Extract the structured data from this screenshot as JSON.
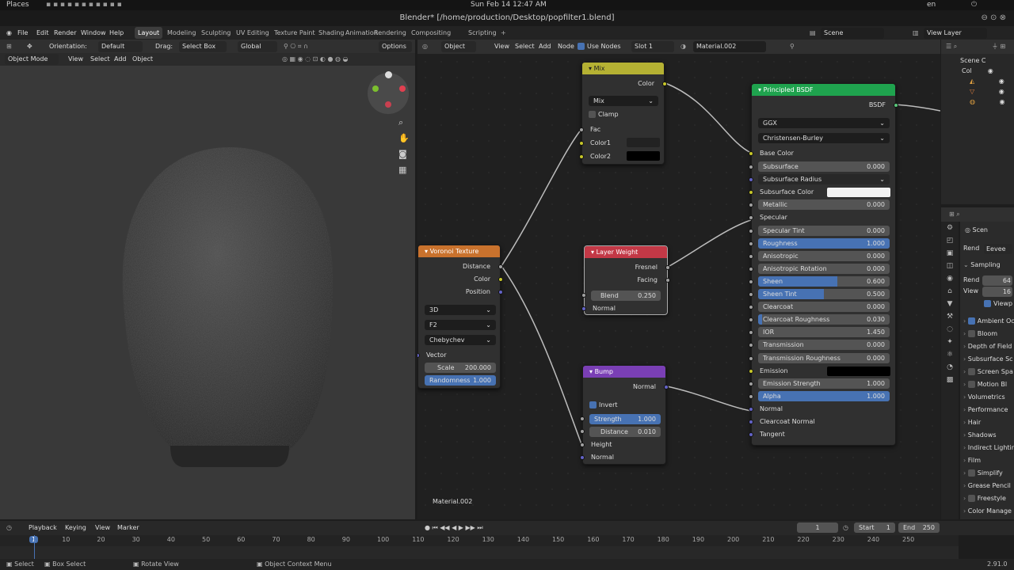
{
  "system": {
    "places": "Places",
    "datetime": "Sun Feb 14  12:47 AM",
    "lang": "en"
  },
  "window": {
    "title": "Blender* [/home/production/Desktop/popfilter1.blend]"
  },
  "menu": {
    "items": [
      "File",
      "Edit",
      "Render",
      "Window",
      "Help"
    ]
  },
  "workspaces": [
    "Layout",
    "Modeling",
    "Sculpting",
    "UV Editing",
    "Texture Paint",
    "Shading",
    "Animation",
    "Rendering",
    "Compositing",
    "Scripting"
  ],
  "active_workspace": "Layout",
  "scene": {
    "label": "Scene",
    "view_layer": "View Layer"
  },
  "viewport_header": {
    "orientation_label": "Orientation:",
    "orientation": "Default",
    "drag_label": "Drag:",
    "drag": "Select Box",
    "transform": "Global",
    "options": "Options",
    "mode": "Object Mode",
    "menus": [
      "View",
      "Select",
      "Add",
      "Object"
    ]
  },
  "node_header": {
    "type": "Object",
    "menus": [
      "View",
      "Select",
      "Add",
      "Node"
    ],
    "use_nodes": "Use Nodes",
    "slot": "Slot 1",
    "material": "Material.002"
  },
  "material_label": "Material.002",
  "nodes": {
    "mix": {
      "title": "Mix",
      "out_color": "Color",
      "blend_type": "Mix",
      "clamp": "Clamp",
      "fac": "Fac",
      "color1": "Color1",
      "color2": "Color2"
    },
    "voronoi": {
      "title": "Voronoi Texture",
      "distance": "Distance",
      "color": "Color",
      "position": "Position",
      "dim": "3D",
      "feature": "F2",
      "metric": "Chebychev",
      "vector": "Vector",
      "scale_label": "Scale",
      "scale": "200.000",
      "rand_label": "Randomness",
      "rand": "1.000"
    },
    "layer_weight": {
      "title": "Layer Weight",
      "fresnel": "Fresnel",
      "facing": "Facing",
      "blend_label": "Blend",
      "blend": "0.250",
      "normal": "Normal"
    },
    "bump": {
      "title": "Bump",
      "normal_out": "Normal",
      "invert": "Invert",
      "strength_label": "Strength",
      "strength": "1.000",
      "distance_label": "Distance",
      "distance": "0.010",
      "height": "Height",
      "normal_in": "Normal"
    },
    "bsdf": {
      "title": "Principled BSDF",
      "out": "BSDF",
      "distribution": "GGX",
      "sss_method": "Christensen-Burley",
      "base_color": "Base Color",
      "rows": [
        {
          "label": "Subsurface",
          "value": "0.000",
          "fill": 0
        },
        {
          "label": "Subsurface Radius",
          "value": "",
          "fill": 0
        },
        {
          "label": "Subsurface Color",
          "value": "",
          "fill": 0
        },
        {
          "label": "Metallic",
          "value": "0.000",
          "fill": 0
        },
        {
          "label": "Specular",
          "value": "",
          "fill": 0
        },
        {
          "label": "Specular Tint",
          "value": "0.000",
          "fill": 0
        },
        {
          "label": "Roughness",
          "value": "1.000",
          "fill": 1
        },
        {
          "label": "Anisotropic",
          "value": "0.000",
          "fill": 0
        },
        {
          "label": "Anisotropic Rotation",
          "value": "0.000",
          "fill": 0
        },
        {
          "label": "Sheen",
          "value": "0.600",
          "fill": 0.6
        },
        {
          "label": "Sheen Tint",
          "value": "0.500",
          "fill": 0.5
        },
        {
          "label": "Clearcoat",
          "value": "0.000",
          "fill": 0
        },
        {
          "label": "Clearcoat Roughness",
          "value": "0.030",
          "fill": 0.03
        },
        {
          "label": "IOR",
          "value": "1.450",
          "fill": 0
        },
        {
          "label": "Transmission",
          "value": "0.000",
          "fill": 0
        },
        {
          "label": "Transmission Roughness",
          "value": "0.000",
          "fill": 0
        },
        {
          "label": "Emission",
          "value": "",
          "fill": 0
        },
        {
          "label": "Emission Strength",
          "value": "1.000",
          "fill": 0
        },
        {
          "label": "Alpha",
          "value": "1.000",
          "fill": 1
        },
        {
          "label": "Normal",
          "value": "",
          "fill": 0
        },
        {
          "label": "Clearcoat Normal",
          "value": "",
          "fill": 0
        },
        {
          "label": "Tangent",
          "value": "",
          "fill": 0
        }
      ]
    }
  },
  "outliner": {
    "scene_collection": "Scene C",
    "collection": "Col"
  },
  "properties": {
    "scene": "Scen",
    "render_engine_label": "Rend",
    "render_engine": "Eevee",
    "sampling": "Sampling",
    "render_label": "Rend",
    "render_samples": "64",
    "viewport_label": "View",
    "viewport_samples": "16",
    "viewport_denoise": "Viewp",
    "panels": [
      {
        "label": "Ambient Oc",
        "checkbox": true,
        "checked": true
      },
      {
        "label": "Bloom",
        "checkbox": true,
        "checked": false
      },
      {
        "label": "Depth of Field",
        "checkbox": false,
        "checked": false
      },
      {
        "label": "Subsurface Sc",
        "checkbox": false,
        "checked": false
      },
      {
        "label": "Screen Spa",
        "checkbox": true,
        "checked": false
      },
      {
        "label": "Motion Bl",
        "checkbox": true,
        "checked": false
      },
      {
        "label": "Volumetrics",
        "checkbox": false,
        "checked": false
      },
      {
        "label": "Performance",
        "checkbox": false,
        "checked": false
      },
      {
        "label": "Hair",
        "checkbox": false,
        "checked": false
      },
      {
        "label": "Shadows",
        "checkbox": false,
        "checked": false
      },
      {
        "label": "Indirect Lightin",
        "checkbox": false,
        "checked": false
      },
      {
        "label": "Film",
        "checkbox": false,
        "checked": false
      },
      {
        "label": "Simplify",
        "checkbox": true,
        "checked": false
      },
      {
        "label": "Grease Pencil",
        "checkbox": false,
        "checked": false
      },
      {
        "label": "Freestyle",
        "checkbox": true,
        "checked": false
      },
      {
        "label": "Color Manage",
        "checkbox": false,
        "checked": false
      }
    ]
  },
  "timeline": {
    "menus": [
      "Playback",
      "Keying",
      "View",
      "Marker"
    ],
    "current_frame": "1",
    "start_label": "Start",
    "start": "1",
    "end_label": "End",
    "end": "250",
    "ticks": [
      "1",
      "10",
      "20",
      "30",
      "40",
      "50",
      "60",
      "70",
      "80",
      "90",
      "100",
      "110",
      "120",
      "130",
      "140",
      "150",
      "160",
      "170",
      "180",
      "190",
      "200",
      "210",
      "220",
      "230",
      "240",
      "250"
    ]
  },
  "status": {
    "select": "Select",
    "box_select": "Box Select",
    "rotate": "Rotate View",
    "context": "Object Context Menu",
    "version": "2.91.0"
  },
  "colors": {
    "mix_header": "#b5b133",
    "voronoi_header": "#c9722d",
    "layer_weight_header": "#c33846",
    "bump_header": "#7a3fb5",
    "bsdf_header": "#1fa34e",
    "accent": "#4772b3"
  }
}
